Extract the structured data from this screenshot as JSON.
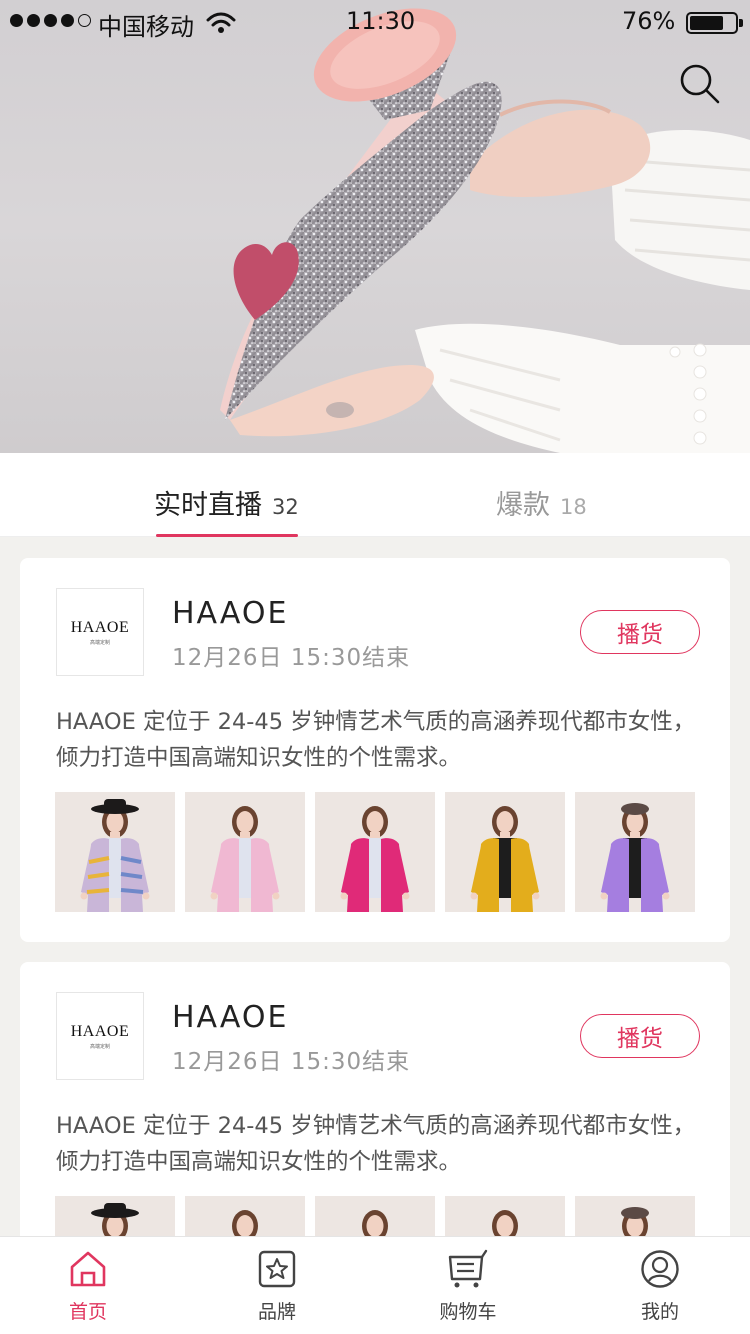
{
  "status_bar": {
    "carrier": "中国移动",
    "time": "11:30",
    "battery_percent": "76%",
    "battery_level": 0.76,
    "signal_bars_filled": 4,
    "signal_bars_total": 5
  },
  "hero": {
    "icons": {
      "search": "search-icon"
    }
  },
  "tabs": [
    {
      "label": "实时直播",
      "count": "32",
      "active": true
    },
    {
      "label": "爆款",
      "count": "18",
      "active": false
    }
  ],
  "cards": [
    {
      "logo_text": "HAAOE",
      "logo_subtext": "高端定制",
      "brand": "HAAOE",
      "time": "12月26日 15:30结束",
      "button_label": "播货",
      "description": "HAAOE 定位于 24-45 岁钟情艺术气质的高涵养现代都市女性，倾力打造中国高端知识女性的个性需求。",
      "thumbnails": [
        {
          "coat_color": "#c9b6d8",
          "item": "printed coat with black hat"
        },
        {
          "coat_color": "#f0b8d2",
          "item": "pink coat"
        },
        {
          "coat_color": "#e02a78",
          "item": "magenta coat"
        },
        {
          "coat_color": "#e3ad1c",
          "item": "mustard coat"
        },
        {
          "coat_color": "#a57ee0",
          "item": "lilac coat"
        }
      ]
    },
    {
      "logo_text": "HAAOE",
      "logo_subtext": "高端定制",
      "brand": "HAAOE",
      "time": "12月26日 15:30结束",
      "button_label": "播货",
      "description": "HAAOE 定位于 24-45 岁钟情艺术气质的高涵养现代都市女性，倾力打造中国高端知识女性的个性需求。",
      "thumbnails": [
        {
          "coat_color": "#c9b6d8",
          "item": "printed coat with black hat"
        },
        {
          "coat_color": "#f0b8d2",
          "item": "pink coat"
        },
        {
          "coat_color": "#e02a78",
          "item": "magenta coat"
        },
        {
          "coat_color": "#e3ad1c",
          "item": "mustard coat"
        },
        {
          "coat_color": "#a57ee0",
          "item": "lilac coat"
        }
      ]
    }
  ],
  "bottom_nav": [
    {
      "label": "首页",
      "icon": "home-icon",
      "active": true
    },
    {
      "label": "品牌",
      "icon": "brand-icon",
      "active": false
    },
    {
      "label": "购物车",
      "icon": "cart-icon",
      "active": false
    },
    {
      "label": "我的",
      "icon": "profile-icon",
      "active": false
    }
  ],
  "colors": {
    "accent": "#e0365f",
    "background": "#f2f1ee",
    "text_primary": "#222222",
    "text_secondary": "#999999"
  }
}
